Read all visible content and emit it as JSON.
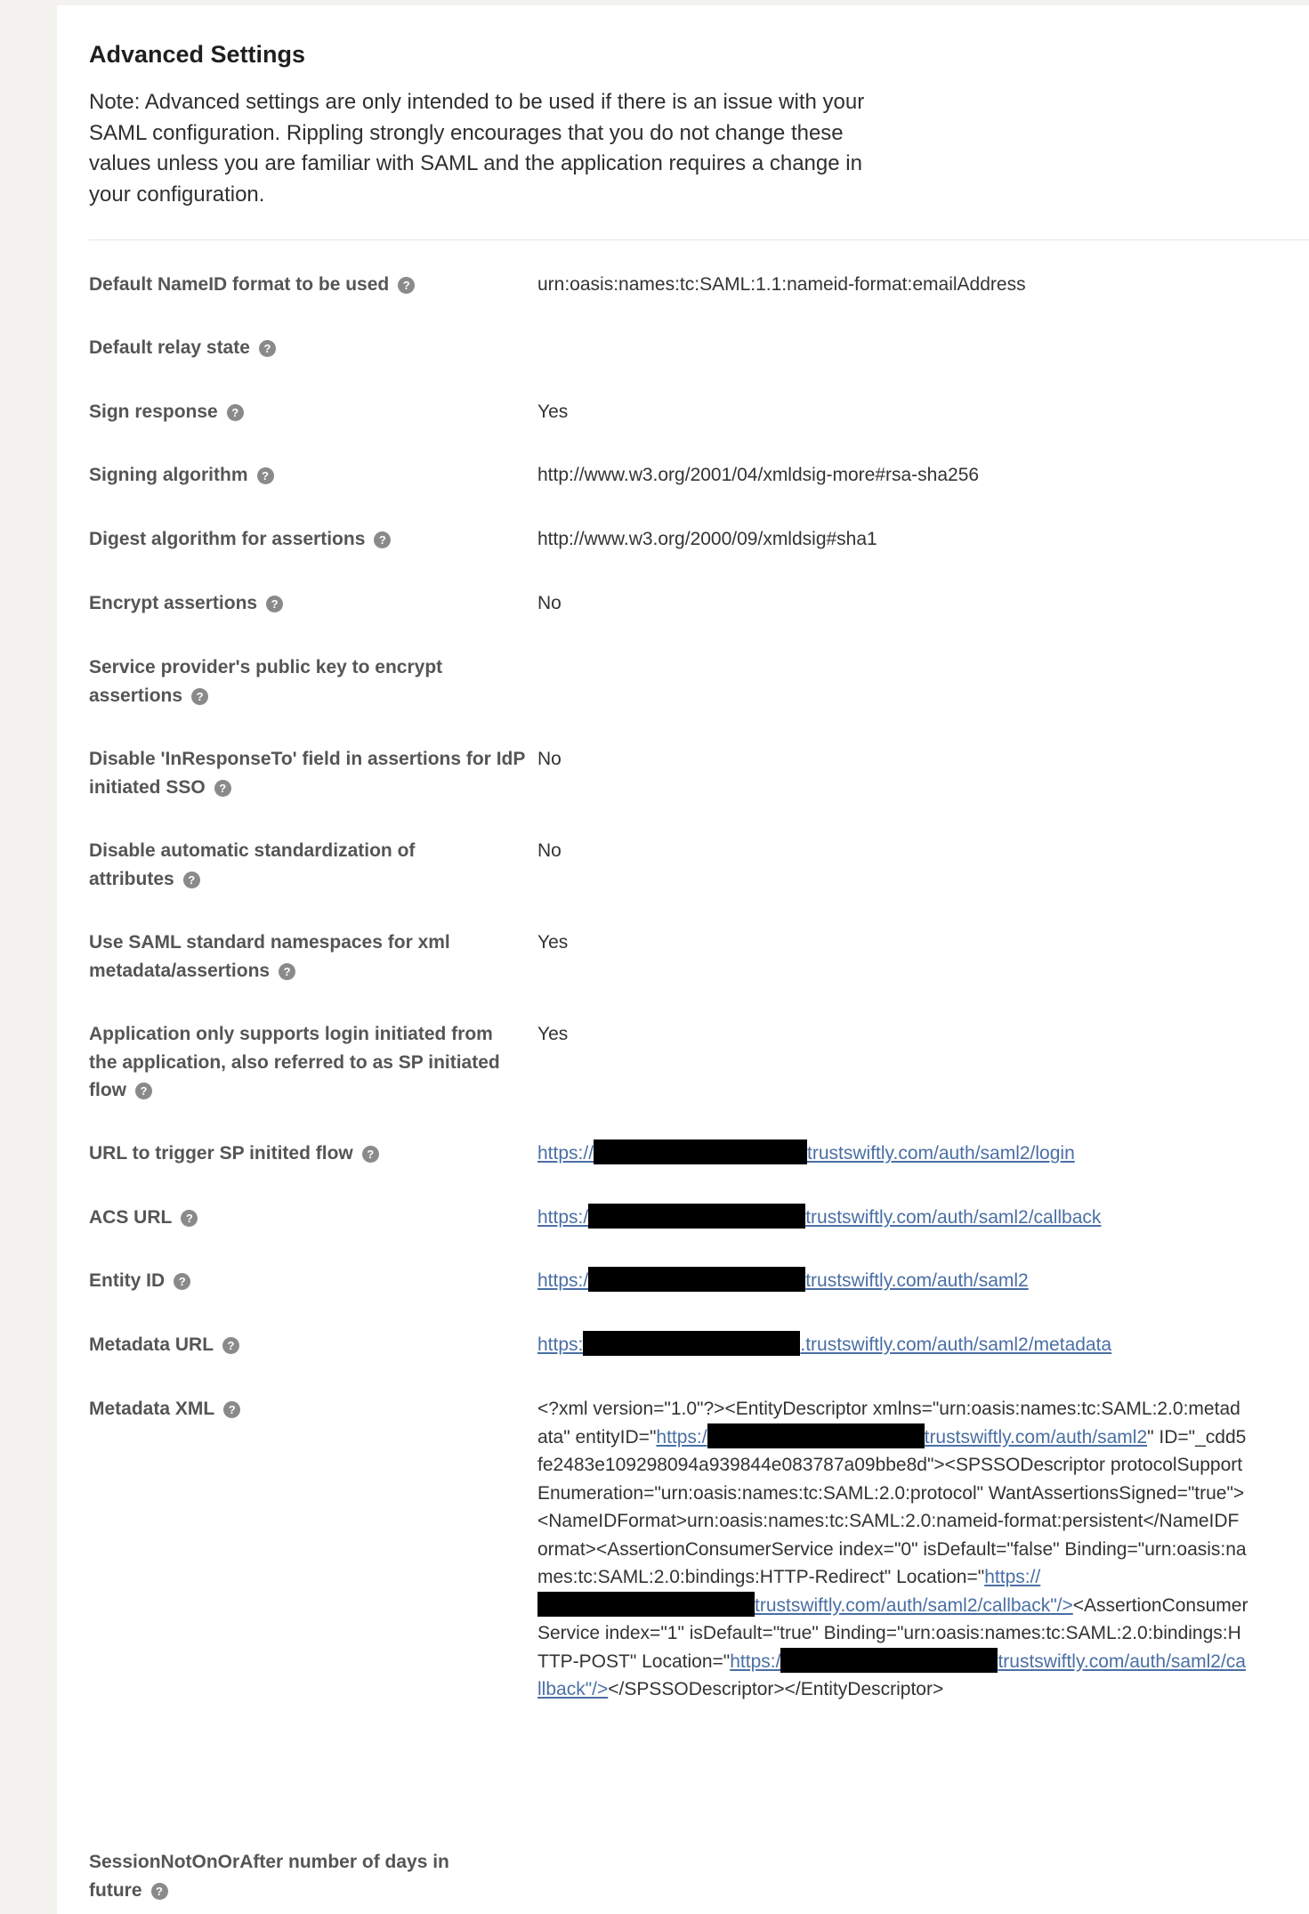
{
  "section": {
    "title": "Advanced Settings",
    "note": "Note: Advanced settings are only intended to be used if there is an issue with your SAML configuration. Rippling strongly encourages that you do not change these values unless you are familiar with SAML and the application requires a change in your configuration."
  },
  "help_icon": "?",
  "rows": {
    "nameid": {
      "label": "Default NameID format to be used",
      "value": "urn:oasis:names:tc:SAML:1.1:nameid-format:emailAddress"
    },
    "relay": {
      "label": "Default relay state",
      "value": ""
    },
    "sign": {
      "label": "Sign response",
      "value": "Yes"
    },
    "sigalg": {
      "label": "Signing algorithm",
      "value": "http://www.w3.org/2001/04/xmldsig-more#rsa-sha256"
    },
    "digest": {
      "label": "Digest algorithm for assertions",
      "value": "http://www.w3.org/2000/09/xmldsig#sha1"
    },
    "encrypt": {
      "label": "Encrypt assertions",
      "value": "No"
    },
    "spkey": {
      "label": "Service provider's public key to encrypt assertions",
      "value": ""
    },
    "inresp": {
      "label": "Disable 'InResponseTo' field in assertions for IdP initiated SSO",
      "value": "No"
    },
    "autostd": {
      "label": "Disable automatic standardization of attributes",
      "value": "No"
    },
    "ns": {
      "label": "Use SAML standard namespaces for xml metadata/assertions",
      "value": "Yes"
    },
    "sponly": {
      "label": "Application only supports login initiated from the application, also referred to as SP initiated flow",
      "value": "Yes"
    },
    "spurl": {
      "label": "URL to trigger SP initited flow",
      "link_prefix": "https://",
      "link_suffix": "trustswiftly.com/auth/saml2/login"
    },
    "acs": {
      "label": "ACS URL",
      "link_prefix": "https:/",
      "link_suffix": "trustswiftly.com/auth/saml2/callback"
    },
    "entity": {
      "label": "Entity ID",
      "link_prefix": "https:/",
      "link_suffix": "trustswiftly.com/auth/saml2"
    },
    "metaurl": {
      "label": "Metadata URL",
      "link_prefix": "https:",
      "link_suffix": ".trustswiftly.com/auth/saml2/metadata"
    },
    "metaxml": {
      "label": "Metadata XML",
      "p1": "<?xml version=\"1.0\"?><EntityDescriptor xmlns=\"urn:oasis:names:tc:SAML:2.0:metadata\" entityID=\"",
      "l1a": "https:/",
      "l1b": "trustswiftly.com/auth/saml2",
      "p2": "\" ID=\"_cdd5fe2483e109298094a939844e083787a09bbe8d\"><SPSSODescriptor protocolSupportEnumeration=\"urn:oasis:names:tc:SAML:2.0:protocol\" WantAssertionsSigned=\"true\"><NameIDFormat>urn:oasis:names:tc:SAML:2.0:nameid-format:persistent</NameIDFormat><AssertionConsumerService index=\"0\" isDefault=\"false\" Binding=\"urn:oasis:names:tc:SAML:2.0:bindings:HTTP-Redirect\" Location=\"",
      "l2a": "https://",
      "l2b": "trustswiftly.com/auth/saml2/callback\"/>",
      "p3": "<AssertionConsumerService index=\"1\" isDefault=\"true\" Binding=\"urn:oasis:names:tc:SAML:2.0:bindings:HTTP-POST\" Location=\"",
      "l3a": "https:/",
      "l3b": "trustswiftly.com/auth/saml2/callback\"/>",
      "p4": "</SPSSODescriptor></EntityDescriptor>"
    },
    "session": {
      "label": "SessionNotOnOrAfter number of days in future",
      "value": ""
    }
  }
}
